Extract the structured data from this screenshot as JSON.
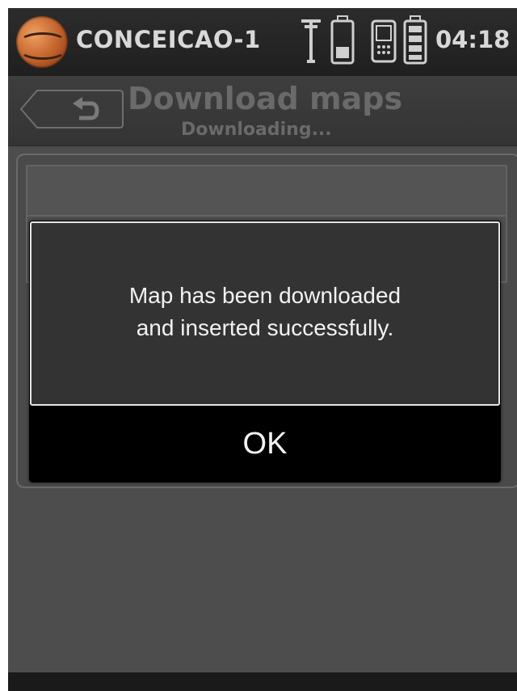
{
  "status_bar": {
    "device_name": "CONCEICAO-1",
    "time": "04:18",
    "icons": [
      "gnss-antenna-icon",
      "battery-icon",
      "controller-icon",
      "controller-battery-icon"
    ]
  },
  "header": {
    "title": "Download maps",
    "subtitle": "Downloading...",
    "back_icon": "back-arrow-icon"
  },
  "dialog": {
    "message": "Map has been downloaded\nand inserted successfully.",
    "ok_label": "OK"
  },
  "colors": {
    "background": "#4d4d4d",
    "status_bar": "#262626",
    "dialog_body": "#333333",
    "dialog_border": "#e6e6e6",
    "button": "#000000",
    "text": "#f2f2f2"
  }
}
